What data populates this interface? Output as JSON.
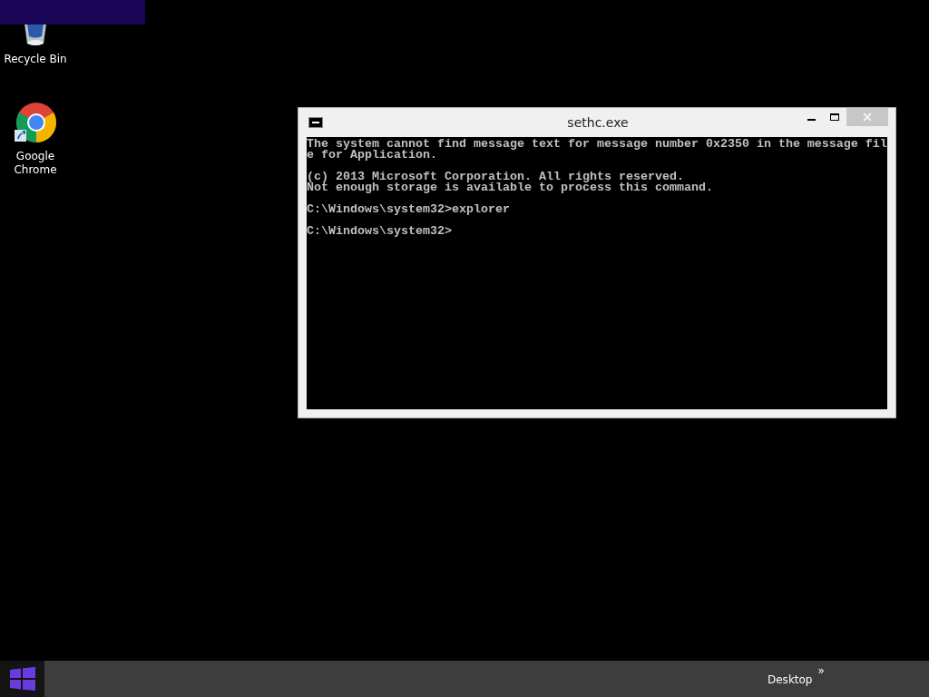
{
  "desktop_icons": [
    {
      "kind": "recycle-bin",
      "label": "Recycle Bin"
    },
    {
      "kind": "chrome",
      "label": "Google Chrome"
    }
  ],
  "window": {
    "title": "sethc.exe",
    "console_blocks": [
      [
        "The system cannot find message text for message number 0x2350 in the message fil",
        "e for Application."
      ],
      [
        "(c) 2013 Microsoft Corporation. All rights reserved.",
        "Not enough storage is available to process this command."
      ],
      [
        "C:\\Windows\\system32>explorer"
      ],
      [
        "C:\\Windows\\system32>"
      ]
    ]
  },
  "taskbar": {
    "toolbar_label": "Desktop",
    "chevron": "»"
  }
}
